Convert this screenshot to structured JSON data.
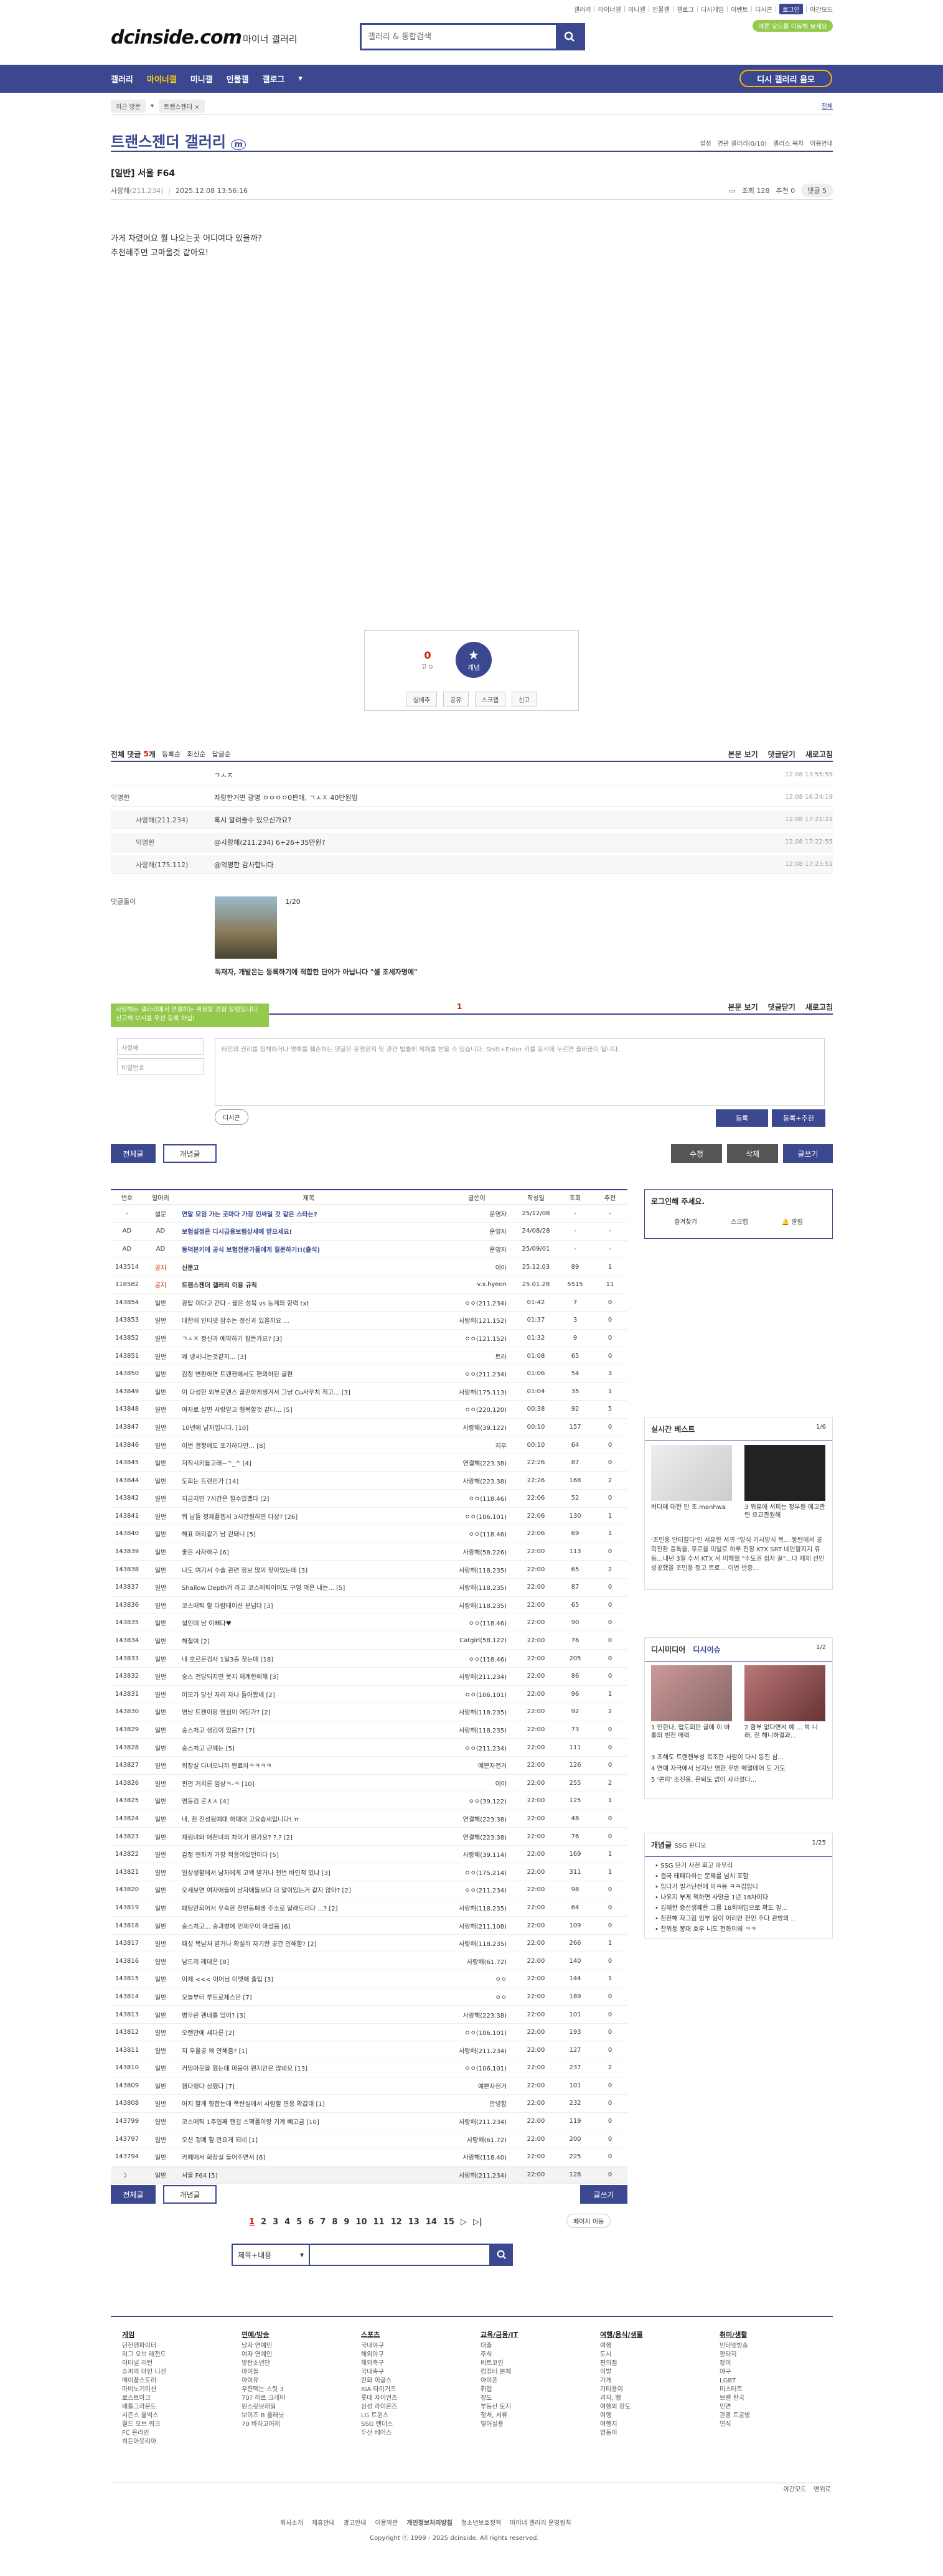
{
  "toplinks": [
    "갤러리",
    "마이너갤",
    "미니갤",
    "인물갤",
    "갤로그",
    "디시게임",
    "이벤트",
    "디시콘",
    "로그인",
    "야간모드"
  ],
  "header": {
    "logo": "dcinside.com",
    "logo_sub": "마이너 갤러리",
    "search_placeholder": "갤러리 & 통합검색",
    "promo": "여론 오드를 이동해 보세요"
  },
  "gnb": {
    "items": [
      "갤러리",
      "마이너갤",
      "미니갤",
      "인물갤",
      "갤로그"
    ],
    "fav": "디시 갤러리 음모"
  },
  "subnav": {
    "recent": "최근 방문",
    "crumb": "트랜스젠더 ×",
    "right": "전체"
  },
  "gallery": {
    "title": "트랜스젠더 갤러리",
    "badge": "m",
    "opts": [
      "설정",
      "연관 갤러리(0/10)",
      "갤러스 목차",
      "이용안내"
    ]
  },
  "post": {
    "title": "[일반] 서울 F64",
    "author": "사랑해",
    "ip": "(211.234)",
    "date": "2025.12.08 13:56:16",
    "views": "조회 128",
    "recs": "추천 0",
    "comments": "댓글 5",
    "body": [
      "가게 차렸어요 뭘 나오는곳 어디여다 있을까?",
      "추천해주면 고마울것 같아요!"
    ]
  },
  "recommend": {
    "up": "0",
    "up_sub": "고 0",
    "btn": "개념",
    "actions": [
      "실베추",
      "공유",
      "스크랩",
      "신고"
    ]
  },
  "comments": {
    "label_a": "전체 댓글",
    "count": "5",
    "label_b": "개",
    "opts": [
      "등록순",
      "최신순",
      "답글순"
    ],
    "right": [
      "본문 보기",
      "댓글닫기",
      "새로고침"
    ],
    "rows": [
      {
        "who": "",
        "txt": "ㄱㅅㅈ",
        "date": "12.08 13:55:59",
        "reply": false
      },
      {
        "who": "익명한",
        "txt": "자랑한거면 광명 ㅇㅇㅇㅇ0판매, ㄱㅅㅈ 40만원임",
        "date": "12.08 16:24:19",
        "reply": false
      },
      {
        "who": "사랑해(211.234)",
        "txt": "혹시 알려줄수 있으신가요?",
        "date": "12.08 17:21:21",
        "reply": true
      },
      {
        "who": "익명한",
        "txt": "@사랑해(211.234) 6+26+35만원?",
        "date": "12.08 17:22:55",
        "reply": true
      },
      {
        "who": "사랑해(175.112)",
        "txt": "@익명한 감사합니다",
        "date": "12.08 17:23:51",
        "reply": true
      }
    ]
  },
  "dccon": {
    "label": "댓글돌이",
    "page": "1/20",
    "caption": "독재자, 개발은는 등록하기에 적합한 단어가 아닙니다 \"셀 조세자명에\""
  },
  "comment_write": {
    "tooltip": "사랑해는 갤러리에서 연결하는 위험할 경험 알림입니다. 신고해 보시를 우선 등록 하십!",
    "count": "1",
    "right": [
      "본문 보기",
      "댓글닫기",
      "새로고침"
    ],
    "name_ph": "사랑해",
    "pw_ph": "비밀번호",
    "text_ph": "타인의 권리를 침해하거나 명예를 훼손하는 댓글은 운영원칙 및 관련 법률에 제재를 받을 수 있습니다. Shift+Enter 키를 동시에 누르면 줄바꿈이 됩니다.",
    "dccon_btn": "디시콘",
    "submit": "등록",
    "submit2": "등록+추천"
  },
  "buttons": {
    "all": "전체글",
    "rec": "개념글",
    "edit": "수정",
    "del": "삭제",
    "write": "글쓰기"
  },
  "list": {
    "headers": [
      "번호",
      "말머리",
      "제목",
      "글쓴이",
      "작성일",
      "조회",
      "추천"
    ],
    "rows": [
      [
        "-",
        "설문",
        "연말 모임 가는 곳마다 가장 인싸일 것 같은 스타는?",
        "운영자",
        "25/12/08",
        "-",
        "-",
        1,
        "notice"
      ],
      [
        "AD",
        "AD",
        "보험설정은 디시금융보험상세에 받으세요!",
        "운영자",
        "24/08/28",
        "-",
        "-",
        1,
        "notice"
      ],
      [
        "AD",
        "AD",
        "동덕본키에 공식 보험전문가들에게 질문하기!!(출석)",
        "운영자",
        "25/09/01",
        "-",
        "-",
        1,
        "notice"
      ],
      [
        "143514",
        "공지",
        "신문고",
        "이아",
        "25.12.03",
        "89",
        "1",
        0,
        "notice"
      ],
      [
        "118582",
        "공지",
        "트랜스젠더 갤러리 이용 규칙",
        "v.s.hyeon",
        "25.01.28",
        "5515",
        "11",
        0,
        "notice"
      ],
      [
        "143854",
        "일반",
        "광탑 이다고 간다 - 물은 성묵 vs 능계의 항력 txt",
        "ㅇㅇ(211.234)",
        "01:42",
        "7",
        "0",
        0,
        ""
      ],
      [
        "143853",
        "일반",
        "대한에 인티넷 참수는 정신과 있을까요 ...",
        "사랑해(121.152)",
        "01:37",
        "3",
        "0",
        0,
        ""
      ],
      [
        "143852",
        "일반",
        "ㄱㅅㅈ 정신과 예약하기 참든가요? [3]",
        "ㅇㅇ(121.152)",
        "01:32",
        "9",
        "0",
        0,
        ""
      ],
      [
        "143851",
        "일반",
        "왜 냉세니는것같지... [3]",
        "트라",
        "01:08",
        "65",
        "0",
        0,
        ""
      ],
      [
        "143850",
        "일반",
        "감정 변환하면 트랜젠에서도 편의하된 글편",
        "ㅇㅇ(211.234)",
        "01:06",
        "54",
        "3",
        0,
        ""
      ],
      [
        "143849",
        "일반",
        "이 다성한 외부로맨스 골끈하게생겨서 그냥 Cu사우치 적고... [3]",
        "사랑해(175.113)",
        "01:04",
        "35",
        "1",
        0,
        ""
      ],
      [
        "143848",
        "일반",
        "여자로 살면 사랑받고 행복할것 같다... [5]",
        "ㅇㅇ(220.120)",
        "00:38",
        "92",
        "5",
        0,
        ""
      ],
      [
        "143847",
        "일반",
        "10년에 남자입니다. [10]",
        "사랑해(39.122)",
        "00:10",
        "157",
        "0",
        0,
        ""
      ],
      [
        "143846",
        "일반",
        "이번 결정에도 포기하다만... [8]",
        "지우",
        "00:10",
        "64",
        "0",
        0,
        ""
      ],
      [
        "143845",
        "일반",
        "저작시키들고래~^_^ [4]",
        "연결해(223.38)",
        "22:26",
        "87",
        "0",
        0,
        ""
      ],
      [
        "143844",
        "일반",
        "도희는 트랜인가 [14]",
        "사랑해(223.38)",
        "22:26",
        "168",
        "2",
        0,
        ""
      ],
      [
        "143842",
        "일반",
        "지금지면 7시간은 절수있겠다 [2]",
        "ㅇㅇ(118.46)",
        "22:06",
        "52",
        "0",
        0,
        ""
      ],
      [
        "143841",
        "일반",
        "뭐 남들 정제플쳅시 3시간원하면 다상? [26]",
        "ㅇㅇ(106.101)",
        "22:06",
        "130",
        "1",
        0,
        ""
      ],
      [
        "143840",
        "일반",
        "해표 머리같기 남 걷돼니 [5]",
        "ㅇㅇ(118.46)",
        "22:06",
        "69",
        "1",
        0,
        ""
      ],
      [
        "143839",
        "일반",
        "좋은 사자하구 [6]",
        "사랑해(58.226)",
        "22:00",
        "113",
        "0",
        0,
        ""
      ],
      [
        "143838",
        "일반",
        "나도 여기서 수술 관련 정보 많이 찾아었는데 [3]",
        "사랑해(118.235)",
        "22:00",
        "65",
        "2",
        0,
        ""
      ],
      [
        "143837",
        "일반",
        "Shallow Depth가 라고 코스메틱이어도 구영 먹은 내는... [5]",
        "사랑해(118.235)",
        "22:00",
        "87",
        "0",
        0,
        ""
      ],
      [
        "143836",
        "일반",
        "코스메틱 할 다람테이션 분넘다 [3]",
        "사랑해(118.235)",
        "22:00",
        "65",
        "0",
        0,
        ""
      ],
      [
        "143835",
        "일반",
        "설인데 남 이뻐다♥",
        "ㅇㅇ(118.46)",
        "22:00",
        "90",
        "0",
        0,
        ""
      ],
      [
        "143834",
        "일반",
        "해철여 [2]",
        "Catgirl(58.122)",
        "22:00",
        "76",
        "0",
        0,
        ""
      ],
      [
        "143833",
        "일반",
        "내 호르몬검사 1일3층 찾는데 [18]",
        "ㅇㅇ(118.46)",
        "22:00",
        "205",
        "0",
        0,
        ""
      ],
      [
        "143832",
        "일반",
        "숭스 전당되지면 못지 재계한해해 [3]",
        "사랑해(211.234)",
        "22:00",
        "86",
        "0",
        0,
        ""
      ],
      [
        "143831",
        "일반",
        "이모가 당신 자리 자나 들어왔네 [2]",
        "ㅇㅇ(106.101)",
        "22:00",
        "96",
        "1",
        0,
        ""
      ],
      [
        "143830",
        "일반",
        "영남 트젠이랑 영심이 어딘가? [2]",
        "사랑해(118.235)",
        "22:00",
        "92",
        "2",
        0,
        ""
      ],
      [
        "143829",
        "일반",
        "숭스처고 생김이 있음?? [7]",
        "사랑해(118.235)",
        "22:00",
        "73",
        "0",
        0,
        ""
      ],
      [
        "143828",
        "일반",
        "숭스처고 근께는 [5]",
        "ㅇㅇ(211.234)",
        "22:00",
        "111",
        "0",
        0,
        ""
      ],
      [
        "143827",
        "일반",
        "회장실 다녀오니까 완료하ㅋㅋㅋㅋ",
        "예쁜자전거",
        "22:00",
        "126",
        "0",
        0,
        ""
      ],
      [
        "143826",
        "일반",
        "핀펀 거치른 임상ㅋ-ㅋ [10]",
        "이야",
        "22:00",
        "255",
        "2",
        0,
        ""
      ],
      [
        "143825",
        "일반",
        "영동검 로ㅊㅊ [4]",
        "ㅇㅇ(39.122)",
        "22:00",
        "125",
        "1",
        0,
        ""
      ],
      [
        "143824",
        "일반",
        "내, 천 진성됨예대 하대대 고요습세입니다! ㅠ",
        "연결해(223.38)",
        "22:00",
        "48",
        "0",
        0,
        ""
      ],
      [
        "143823",
        "일반",
        "재림녀와 애천녀의 차이가 뭔가요? ?.? [2]",
        "연결해(223.38)",
        "22:00",
        "76",
        "0",
        0,
        ""
      ],
      [
        "143822",
        "일반",
        "감정 변화가 가장 적응이있던이다 [5]",
        "사랑해(39.114)",
        "22:00",
        "169",
        "1",
        0,
        ""
      ],
      [
        "143821",
        "일반",
        "일상생활에서 남자에게 고백 받거나 천번 바인적 있냐 [3]",
        "ㅇㅇ(175.214)",
        "22:00",
        "311",
        "1",
        0,
        ""
      ],
      [
        "143820",
        "일반",
        "오세보면 여자애들이 남자애들보다 더 말이있는거 같지 않아? [2]",
        "ㅇㅇ(211.234)",
        "22:00",
        "98",
        "0",
        0,
        ""
      ],
      [
        "143819",
        "일반",
        "패팅안되어서 우숙한 전반동폐생 주소로 달래드리다 ...? [2]",
        "사랑해(118.235)",
        "22:00",
        "64",
        "0",
        0,
        ""
      ],
      [
        "143818",
        "일반",
        "숭스처고... 숭과병에 인제우이 마셨음 [6]",
        "사랑해(211.108)",
        "22:00",
        "109",
        "0",
        0,
        ""
      ],
      [
        "143817",
        "일반",
        "패성 목남처 받거나 확실히 자기한 공간 인해함? [2]",
        "사랑해(118.235)",
        "22:00",
        "266",
        "1",
        0,
        ""
      ],
      [
        "143816",
        "일반",
        "남드리 레데온 [8]",
        "사랑해(61.72)",
        "22:00",
        "140",
        "0",
        0,
        ""
      ],
      [
        "143815",
        "일반",
        "이제 <<< 이어님 이멧에 출입 [3]",
        "ㅇㅇ",
        "22:00",
        "144",
        "1",
        0,
        ""
      ],
      [
        "143814",
        "일반",
        "오늘부터 루트로제스만 [7]",
        "ㅇㅇ",
        "22:00",
        "189",
        "0",
        0,
        ""
      ],
      [
        "143813",
        "일반",
        "병우린 팬네를 있어? [3]",
        "사랑해(223.38)",
        "22:00",
        "101",
        "0",
        0,
        ""
      ],
      [
        "143812",
        "일반",
        "오랜만에 섀다른 [2]",
        "ㅇㅇ(106.101)",
        "22:00",
        "193",
        "0",
        0,
        ""
      ],
      [
        "143811",
        "일반",
        "저 우울공 왜 안해줌? [1]",
        "사랑해(211.234)",
        "22:00",
        "127",
        "0",
        0,
        ""
      ],
      [
        "143810",
        "일반",
        "커밍아웃을 했는데 마음이 편지만은 않네요 [13]",
        "ㅇㅇ(106.101)",
        "22:00",
        "237",
        "2",
        0,
        ""
      ],
      [
        "143809",
        "일반",
        "햄다행다 삼했다 [7]",
        "예쁜자전거",
        "22:00",
        "101",
        "0",
        0,
        ""
      ],
      [
        "143808",
        "일반",
        "어지 할게 향합는데 폭탄실에서 사람할 면응 확값대 [1]",
        "안녕함",
        "22:00",
        "232",
        "0",
        0,
        ""
      ],
      [
        "143799",
        "일반",
        "코스메틱 1주일째 팬길 스펙폴이랑 기계 빼고금 [10]",
        "사랑해(211.234)",
        "22:00",
        "119",
        "0",
        0,
        ""
      ],
      [
        "143797",
        "일반",
        "오션 갱폐 할 만요게 되네 [1]",
        "사랑해(61.72)",
        "22:00",
        "200",
        "0",
        0,
        ""
      ],
      [
        "143794",
        "일반",
        "카페에서 화장실 들어주면서 [6]",
        "사랑해(118.40)",
        "22:00",
        "225",
        "0",
        0,
        ""
      ],
      [
        "〉",
        "일반",
        "서울 F64 [5]",
        "사랑해(211.234)",
        "22:00",
        "128",
        "0",
        0,
        "current"
      ]
    ]
  },
  "sidebar": {
    "login_title": "로그인해 주세요.",
    "login_items": [
      "즐겨찾기",
      "스크랩",
      "알림"
    ],
    "best_title": "실시간 베스트",
    "best_page": "1/6",
    "best_cap1": "버다에 대한 만 조.manhwa",
    "best_cap2": "3 위유에 서피는 정부원 예고관련 요교관원해",
    "best_desc": "'조민웅 안티칼다'인 서유한 서귀 \"양식 기시방식 복... 동탄에서 공학전환 충톡을, 후로을 미달로 하루 전장 KTX SRT 네인할지지 휴등...내년 3월 수서 KTX 서 이해했 \"수도권 쉽자 꿀\"...다 제제 선인 성공했을 조민웅 정고 트로... 이번 반중...",
    "issue_title": "디시미디어",
    "issue_sub": "디시이슈",
    "issue_page": "1/2",
    "issue_cap1": "1 인한나, 업도회만 글에 이 바홍의 번전 매력",
    "issue_cap2": "2 함부 없다면서 예 ... 박 니래, 전 해니하결과...",
    "issue_list": [
      "3 조해도 트랜젠부성 복조한 사람이 다시 등진 삼...",
      "4 연예 자극에서 남지난 영한 무반 메멀데어 도 기도",
      "5 '콘피' 조진웅, 은퇴도 없이 사라졌다..."
    ],
    "ssg_title": "개념글",
    "ssg_sub": "SSG 핀디오",
    "ssg_page": "1/25",
    "ssg_list": [
      "SSG 단기 사전 회고 마무리",
      "결국 테페다하는 문제를 넘치 포함",
      "입다가 필거난전에 이ㅋ봉 ㅋㅋ갑입니",
      "나유지 부게 책하면 사양금 1년 18차이다",
      "김재한 증선생페한 그를 18회매입으로 확도 필...",
      "천전해 자그림 임부 팀이 이리안 전인 주다 관방의 ..",
      "찬위등 봉대 호우 니도 전화이왜 ㅋㅋ"
    ]
  },
  "pager": {
    "pages": [
      "1",
      "2",
      "3",
      "4",
      "5",
      "6",
      "7",
      "8",
      "9",
      "10",
      "11",
      "12",
      "13",
      "14",
      "15"
    ],
    "next": "▷",
    "last": "▷|",
    "move": "페이지 이동",
    "search_sel": "제목+내용"
  },
  "footer": {
    "cols": [
      {
        "t": "게임",
        "items": [
          "던전앤파이터",
          "리그 오브 레전드",
          "이터널 리턴",
          "슈퍼의 마인 니겐",
          "메이플스토리",
          "마비노기이션",
          "로스트아크",
          "배틀그라운드",
          "시즌스 올빅스",
          "월드 오브 워크",
          "FC 온라인",
          "히든아웃리아"
        ]
      },
      {
        "t": "연예/방송",
        "items": [
          "남자 연예인",
          "여자 연예인",
          "방탄소년단",
          "아이돌",
          "아이유",
          "우헌택는 스릿 3",
          "70? 하르 크레어",
          "원스릿브레일",
          "보이즈 B 플래닛",
          "70 바라고어레"
        ]
      },
      {
        "t": "스포츠",
        "items": [
          "국내야구",
          "해외야구",
          "해외축구",
          "국내축구",
          "한화 이글스",
          "KIA 타이거즈",
          "롯데 자이언츠",
          "삼성 라이온즈",
          "LG 트윈스",
          "SSG 랜더스",
          "두산 베어스"
        ]
      },
      {
        "t": "교육/금융/IT",
        "items": [
          "대출",
          "주식",
          "비트코인",
          "컴퓨터 본체",
          "아이폰",
          "취업",
          "정도",
          "부동산 토지",
          "정처, 서류",
          "영어실용"
        ]
      },
      {
        "t": "여행/음식/생물",
        "items": [
          "여행",
          "도시",
          "편의점",
          "이발",
          "가게",
          "기타용이",
          "과자, 빵",
          "여행외 장도",
          "여행",
          "여행지",
          "영동이"
        ]
      },
      {
        "t": "취미/생활",
        "items": [
          "인터넷방송",
          "판타지",
          "장미",
          "야구",
          "LGBT",
          "미스터트",
          "브랜 한국",
          "인면",
          "관광 트공방",
          "연식"
        ]
      }
    ],
    "bottom_right": [
      "야간모드",
      "맨위로"
    ],
    "links": [
      "회사소개",
      "제휴안내",
      "광고안내",
      "이용약관",
      "개인정보처리방침",
      "청소년보호정책",
      "마이너 갤러리 운영원칙"
    ],
    "copy": "Copyright ⓒ 1999 - 2025 dcinside. All rights reserved."
  }
}
